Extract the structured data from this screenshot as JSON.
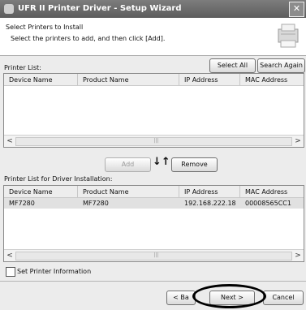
{
  "window": {
    "title": "UFR II Printer Driver - Setup Wizard",
    "close": "✕"
  },
  "header": {
    "title": "Select Printers to Install",
    "subtitle": "Select the printers to add, and then click [Add]."
  },
  "printer_list": {
    "label": "Printer List:",
    "select_all": "Select All",
    "search_again": "Search Again",
    "columns": [
      "Device Name",
      "Product Name",
      "IP Address",
      "MAC Address"
    ]
  },
  "transfer": {
    "add": "Add",
    "remove": "Remove",
    "arrows": "↓↑"
  },
  "install_list": {
    "label": "Printer List for Driver Installation:",
    "columns": [
      "Device Name",
      "Product Name",
      "IP Address",
      "MAC Address"
    ],
    "rows": [
      {
        "device": "MF7280",
        "product": "MF7280",
        "ip": "192.168.222.18",
        "mac": "00008565CC1"
      }
    ]
  },
  "set_info": "Set Printer Information",
  "footer": {
    "back": "< Ba",
    "next": "Next >",
    "cancel": "Cancel"
  },
  "scroll": {
    "left": "<",
    "right": ">",
    "grip": "|||"
  }
}
